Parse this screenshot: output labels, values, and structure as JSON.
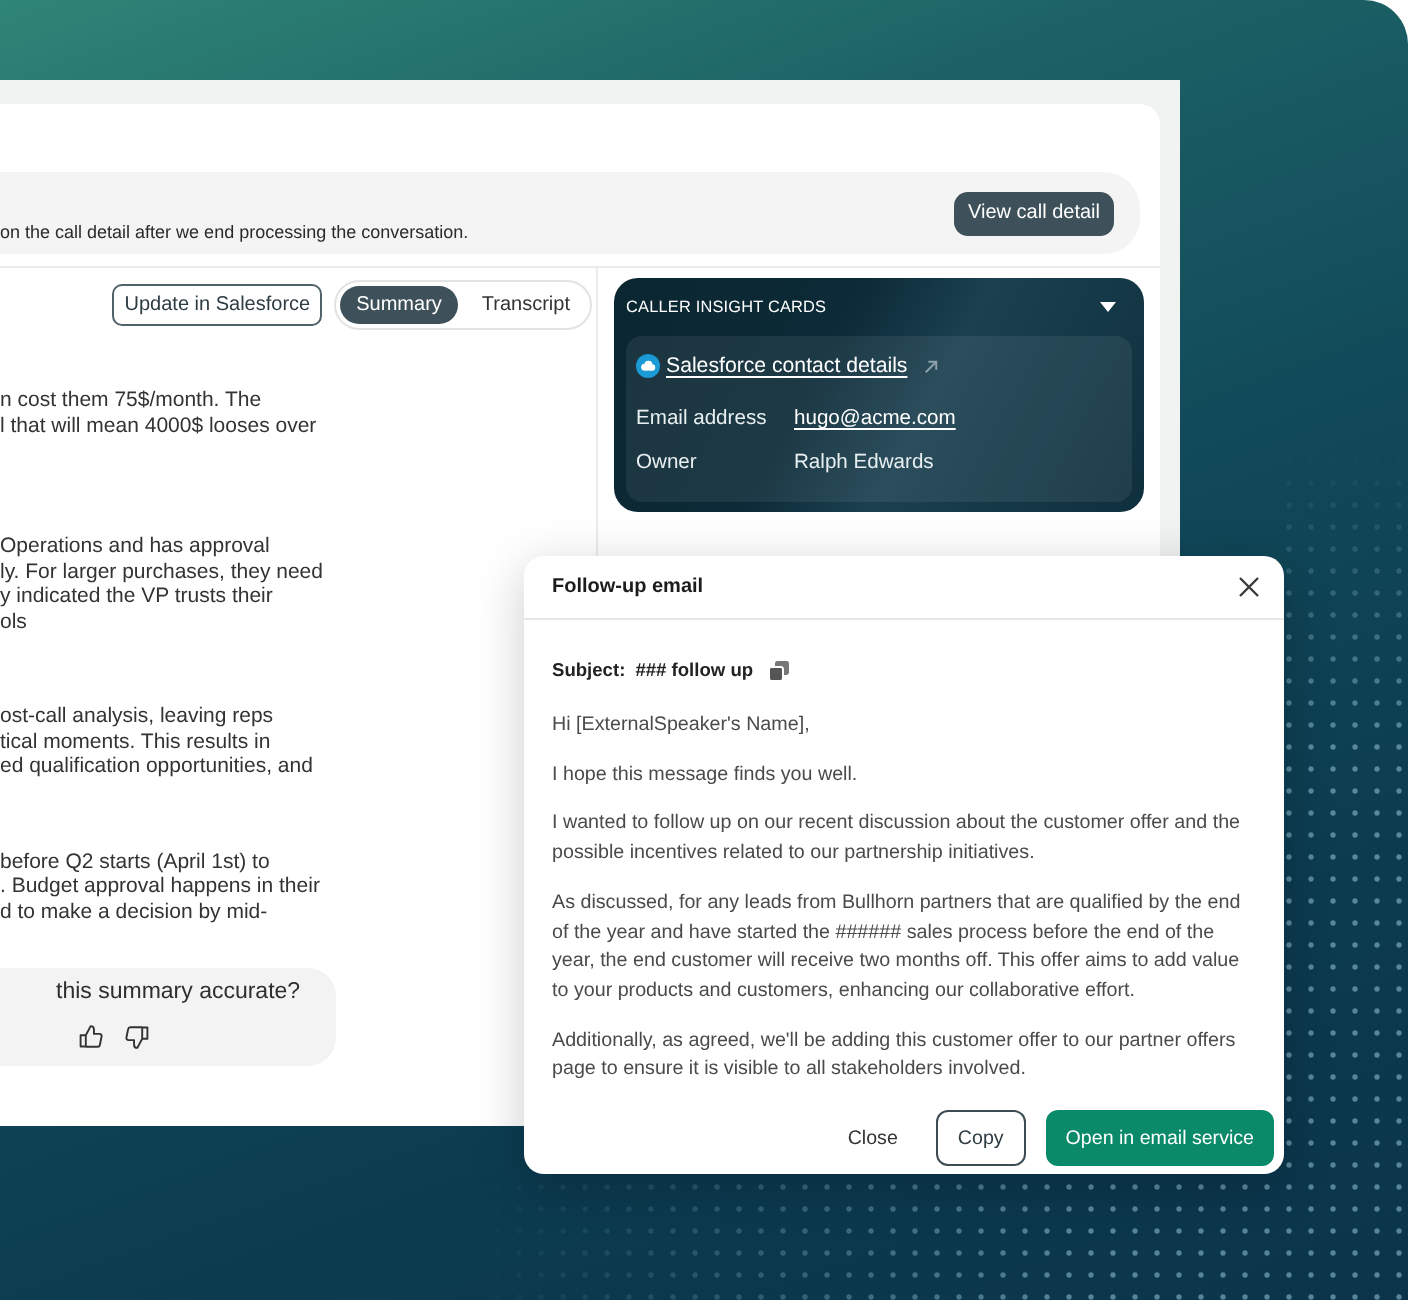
{
  "call_notice": {
    "text": "on the call detail after we end processing the conversation.",
    "button": "View call detail"
  },
  "summary_panel": {
    "action_button": "Update in Salesforce",
    "tabs": [
      {
        "label": "Summary",
        "selected": true
      },
      {
        "label": "Transcript",
        "selected": false
      }
    ],
    "paragraphs": [
      {
        "lines": [
          "n cost them 75$/month. The",
          "l that will mean 4000$ looses over"
        ]
      },
      {
        "lines": [
          "Operations and has approval",
          "ly. For larger purchases, they need",
          "y indicated the VP trusts their",
          "ols"
        ]
      },
      {
        "lines": [
          "ost-call analysis, leaving reps",
          "tical moments. This results in",
          "ed qualification opportunities, and"
        ]
      },
      {
        "lines": [
          "before Q2 starts (April 1st) to",
          ". Budget approval happens in their",
          "d to make a decision by mid-"
        ]
      }
    ],
    "feedback": {
      "question": "this summary accurate?"
    }
  },
  "caller_insight_cards": {
    "title": "CALLER INSIGHT CARDS",
    "link": "Salesforce contact details",
    "fields": [
      {
        "label": "Email address",
        "value": "hugo@acme.com",
        "kind": "link"
      },
      {
        "label": "Owner",
        "value": "Ralph Edwards",
        "kind": "text"
      }
    ]
  },
  "follow_up_email": {
    "title": "Follow-up email",
    "subject_label": "Subject:",
    "subject": "### follow up",
    "paragraphs": [
      "Hi [ExternalSpeaker's Name],",
      "I hope this message finds you well.",
      "I wanted to follow up on our recent discussion about the customer offer and the possible incentives related to our partnership initiatives.",
      "As discussed, for any leads from Bullhorn partners that are qualified by the end of the year and have started the ###### sales process before the end of the year, the end customer will receive two months off. This offer aims to add value to your products and customers, enhancing our collaborative effort.",
      "Additionally, as agreed, we'll be adding this customer offer to our partner offers page to ensure it is visible to all stakeholders involved."
    ],
    "buttons": [
      {
        "label": "Close",
        "kind": "text"
      },
      {
        "label": "Copy",
        "kind": "outline"
      },
      {
        "label": "Open in email service",
        "kind": "primary"
      }
    ]
  }
}
